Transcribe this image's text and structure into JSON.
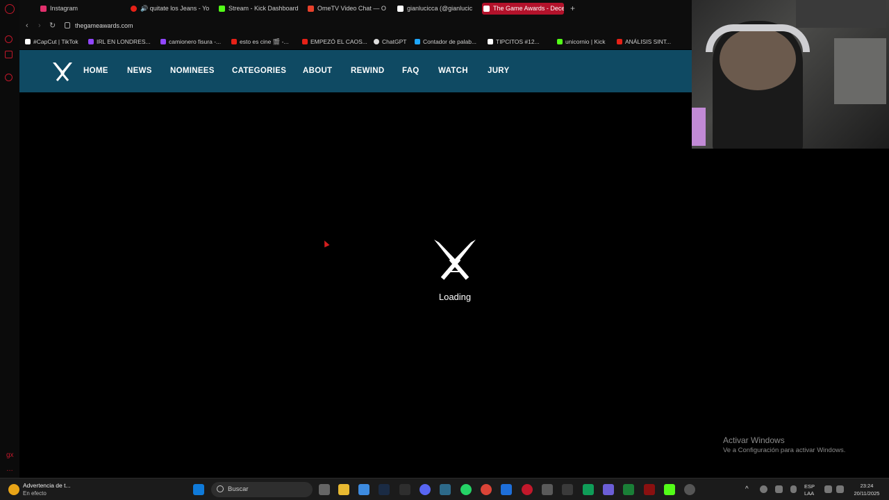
{
  "browser": {
    "tabs": [
      {
        "label": "Instagram",
        "color": "#e1306c"
      },
      {
        "label": "🔊 quitate los Jeans - Yo",
        "color": "#e62117"
      },
      {
        "label": "Stream - Kick Dashboard",
        "color": "#53fc18"
      },
      {
        "label": "OmeTV Video Chat — Om",
        "color": "#e8412b"
      },
      {
        "label": "gianlucicca (@gianlucic",
        "color": "#ffffff"
      },
      {
        "label": "The Game Awards - Dece",
        "color": "#ffffff",
        "active": true
      }
    ],
    "new_tab": "+",
    "url": "thegameawards.com",
    "bookmarks": [
      {
        "label": "#CapCut | TikTok",
        "color": "#ffffff"
      },
      {
        "label": "IRL EN LONDRES...",
        "color": "#9146ff"
      },
      {
        "label": "camionero fisura -...",
        "color": "#9146ff"
      },
      {
        "label": "esto es cine 🎬 -...",
        "color": "#e62117"
      },
      {
        "label": "EMPEZÓ EL CAOS...",
        "color": "#e62117"
      },
      {
        "label": "ChatGPT",
        "color": "#dddddd"
      },
      {
        "label": "Contador de palab...",
        "color": "#1ea7fd"
      },
      {
        "label": "TIPCITOS #12...",
        "color": "#ffffff"
      },
      {
        "label": "unicornio | Kick",
        "color": "#53fc18"
      },
      {
        "label": "ANÁLISIS SINT...",
        "color": "#e62117"
      }
    ]
  },
  "site": {
    "nav": [
      "HOME",
      "NEWS",
      "NOMINEES",
      "CATEGORIES",
      "ABOUT",
      "REWIND",
      "FAQ",
      "WATCH",
      "JURY"
    ],
    "loading_text": "Loading"
  },
  "overlay": {
    "activate_title": "Activar Windows",
    "activate_sub": "Ve a Configuración para activar Windows."
  },
  "taskbar": {
    "notif_title": "Advertencia de t...",
    "notif_sub": "En efecto",
    "search_placeholder": "Buscar",
    "lang_top": "ESP",
    "lang_bottom": "LAA",
    "time": "23:24",
    "date": "20/11/2025"
  },
  "colors": {
    "header_bg": "#0f4a63",
    "active_tab": "#b3122b",
    "opera_red": "#c2182b"
  }
}
